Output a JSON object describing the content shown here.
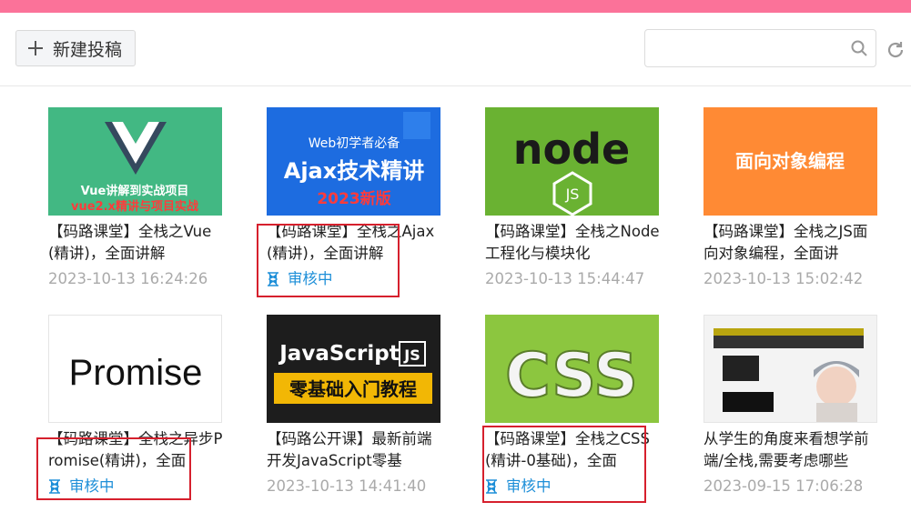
{
  "toolbar": {
    "new_post_label": "新建投稿",
    "search_placeholder": "",
    "search_value": ""
  },
  "colors": {
    "top_accent": "#fb7299",
    "status_text": "#1e8fd8",
    "highlight_box": "#d6202d"
  },
  "cards": [
    {
      "title": "【码路课堂】全栈之Vue(精讲)，全面讲解",
      "meta": "2023-10-13 16:24:26",
      "thumb": {
        "logo": "V",
        "line1": "Vue讲解到实战项目",
        "line2": "vue2.x精讲与项目实战",
        "bg": "#42b883"
      }
    },
    {
      "title": "【码路课堂】全栈之Ajax(精讲)，全面讲解",
      "status": "审核中",
      "status_icon": "hourglass-icon",
      "thumb": {
        "line1": "Web初学者必备",
        "line2": "Ajax技术精讲",
        "line3": "2023新版",
        "bg": "#1a5fd8"
      }
    },
    {
      "title": "【码路课堂】全栈之Node工程化与模块化",
      "meta": "2023-10-13 15:44:47",
      "thumb": {
        "logo": "node",
        "badge": "JS",
        "bg": "#6ab232"
      }
    },
    {
      "title": "【码路课堂】全栈之JS面向对象编程，全面讲",
      "meta": "2023-10-13 15:02:42",
      "thumb": {
        "line1": "面向对象编程",
        "bg": "#ff8a34"
      }
    },
    {
      "title": "【码路课堂】全栈之异步Promise(精讲)，全面",
      "status": "审核中",
      "status_icon": "hourglass-icon",
      "thumb": {
        "line1": "Promise",
        "bg": "#ffffff"
      }
    },
    {
      "title": "【码路公开课】最新前端开发JavaScript零基",
      "meta": "2023-10-13 14:41:40",
      "thumb": {
        "line1": "JavaScript",
        "badge": "JS",
        "line2": "零基础入门教程",
        "bg": "#1d1d1d"
      }
    },
    {
      "title": "【码路课堂】全栈之CSS(精讲-0基础)，全面",
      "status": "审核中",
      "status_icon": "hourglass-icon",
      "thumb": {
        "line1": "CSS",
        "bg": "#8cc63f"
      }
    },
    {
      "title": "从学生的角度来看想学前端/全栈,需要考虑哪些",
      "meta": "2023-09-15 17:06:28",
      "thumb": {
        "bg": "#f3f3f3"
      }
    }
  ]
}
